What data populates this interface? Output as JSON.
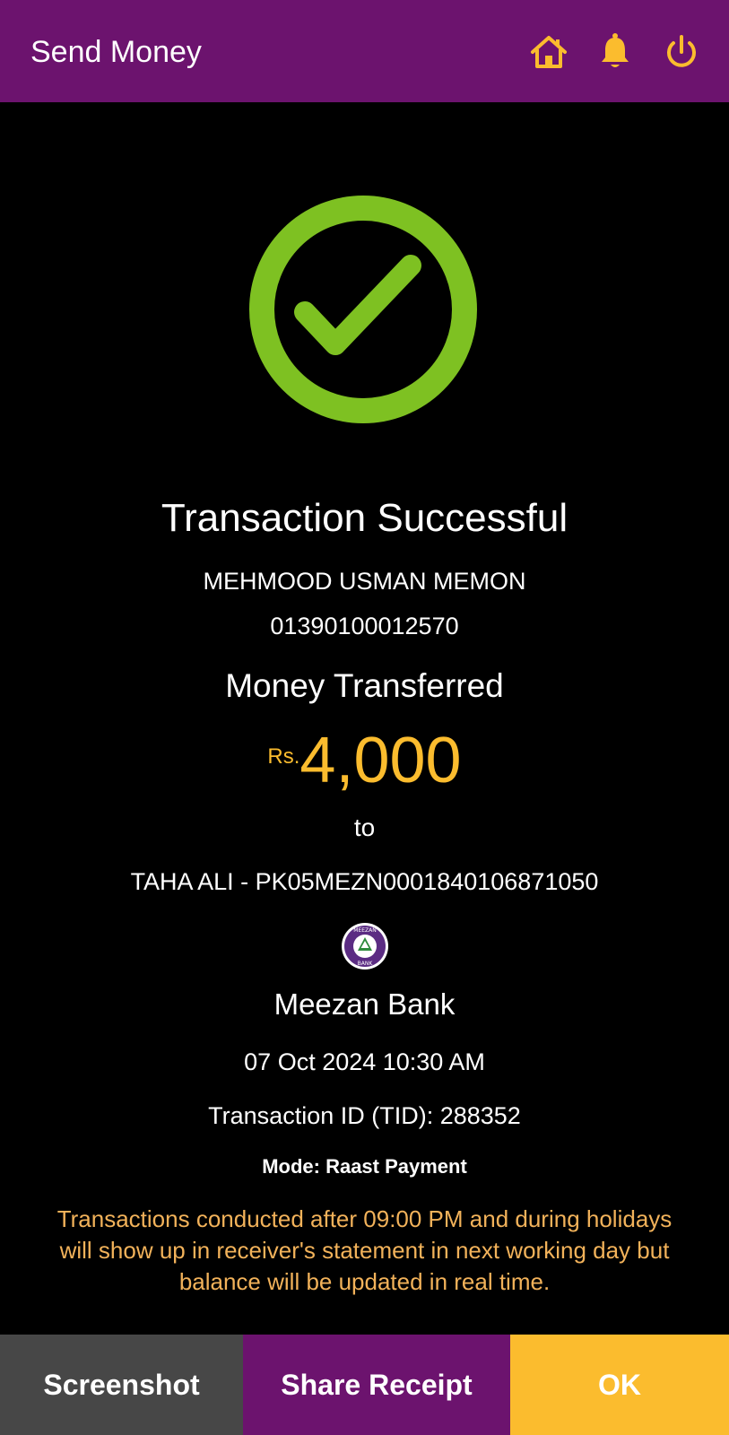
{
  "header": {
    "title": "Send Money",
    "icons": [
      "home-icon",
      "bell-icon",
      "power-icon"
    ]
  },
  "colors": {
    "header_bg": "#6c136e",
    "accent": "#fbbc2e",
    "success": "#7ec122",
    "notice": "#f2b25a",
    "screenshot_bg": "#474747"
  },
  "status": {
    "icon": "check-circle-icon",
    "title": "Transaction Successful"
  },
  "sender": {
    "name": "MEHMOOD USMAN MEMON",
    "account": "01390100012570"
  },
  "transfer": {
    "label": "Money Transferred",
    "currency": "Rs.",
    "amount": "4,000",
    "to_label": "to",
    "recipient": "TAHA ALI - PK05MEZN0001840106871050"
  },
  "bank": {
    "logo_text_top": "MEEZAN",
    "logo_text_bottom": "BANK",
    "name": "Meezan Bank"
  },
  "details": {
    "datetime": "07 Oct 2024 10:30 AM",
    "tid": "Transaction ID (TID): 288352",
    "mode": "Mode: Raast Payment"
  },
  "notice": "Transactions conducted after 09:00 PM and during holidays will show up in receiver's statement in next working day but balance will be updated in real time.",
  "actions": {
    "screenshot": "Screenshot",
    "share": "Share Receipt",
    "ok": "OK"
  }
}
